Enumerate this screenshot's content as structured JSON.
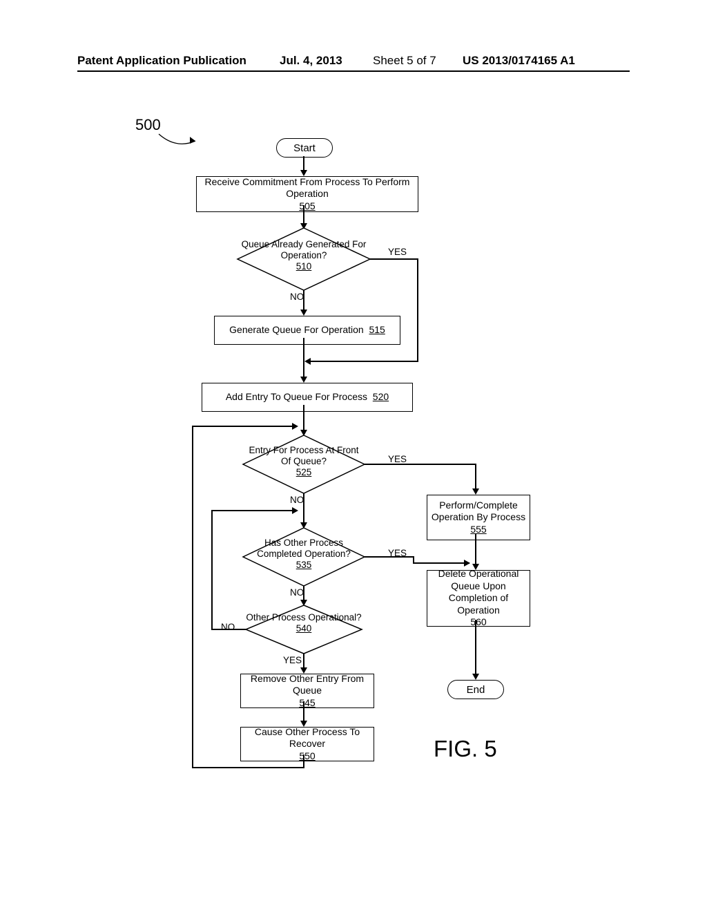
{
  "header": {
    "pub": "Patent Application Publication",
    "date": "Jul. 4, 2013",
    "sheet": "Sheet 5 of 7",
    "pubno": "US 2013/0174165 A1"
  },
  "figure_number": "500",
  "figure_label": "FIG. 5",
  "chart_data": {
    "type": "flowchart",
    "nodes": [
      {
        "id": "start",
        "type": "terminator",
        "label": "Start"
      },
      {
        "id": "505",
        "type": "process",
        "label": "Receive Commitment From Process To Perform Operation",
        "ref": "505"
      },
      {
        "id": "510",
        "type": "decision",
        "label": "Queue Already Generated For Operation?",
        "ref": "510"
      },
      {
        "id": "515",
        "type": "process",
        "label": "Generate Queue For Operation",
        "ref": "515"
      },
      {
        "id": "520",
        "type": "process",
        "label": "Add Entry To Queue For Process",
        "ref": "520"
      },
      {
        "id": "525",
        "type": "decision",
        "label": "Entry For Process At Front Of Queue?",
        "ref": "525"
      },
      {
        "id": "535",
        "type": "decision",
        "label": "Has Other Process Completed Operation?",
        "ref": "535"
      },
      {
        "id": "540",
        "type": "decision",
        "label": "Other Process Operational?",
        "ref": "540"
      },
      {
        "id": "545",
        "type": "process",
        "label": "Remove Other Entry From Queue",
        "ref": "545"
      },
      {
        "id": "550",
        "type": "process",
        "label": "Cause Other Process To Recover",
        "ref": "550"
      },
      {
        "id": "555",
        "type": "process",
        "label": "Perform/Complete Operation By Process",
        "ref": "555"
      },
      {
        "id": "560",
        "type": "process",
        "label": "Delete Operational Queue Upon Completion of Operation",
        "ref": "560"
      },
      {
        "id": "end",
        "type": "terminator",
        "label": "End"
      }
    ],
    "edges": [
      {
        "from": "start",
        "to": "505"
      },
      {
        "from": "505",
        "to": "510"
      },
      {
        "from": "510",
        "to": "515",
        "label": "NO"
      },
      {
        "from": "510",
        "to": "520",
        "label": "YES"
      },
      {
        "from": "515",
        "to": "520"
      },
      {
        "from": "520",
        "to": "525"
      },
      {
        "from": "525",
        "to": "555",
        "label": "YES"
      },
      {
        "from": "525",
        "to": "535",
        "label": "NO"
      },
      {
        "from": "535",
        "to": "560",
        "label": "YES"
      },
      {
        "from": "535",
        "to": "540",
        "label": "NO"
      },
      {
        "from": "540",
        "to": "545",
        "label": "YES"
      },
      {
        "from": "540",
        "to": "525",
        "label": "NO",
        "note": "loop back"
      },
      {
        "from": "545",
        "to": "550"
      },
      {
        "from": "550",
        "to": "525",
        "note": "loop back"
      },
      {
        "from": "555",
        "to": "560"
      },
      {
        "from": "560",
        "to": "end"
      }
    ],
    "branch_labels": {
      "yes_510": "YES",
      "no_510": "NO",
      "yes_525": "YES",
      "no_525": "NO",
      "yes_535": "YES",
      "no_535": "NO",
      "yes_540": "YES",
      "no_540": "NO"
    }
  }
}
